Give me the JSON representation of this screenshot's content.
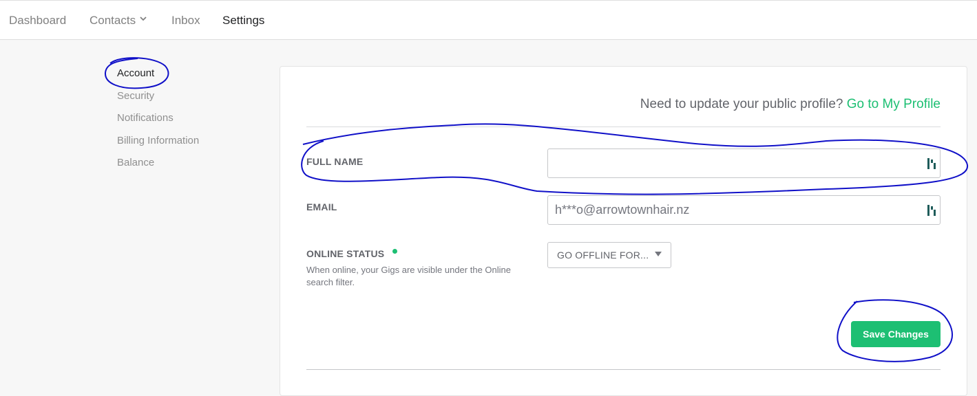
{
  "nav": {
    "items": [
      {
        "label": "Dashboard"
      },
      {
        "label": "Contacts"
      },
      {
        "label": "Inbox"
      },
      {
        "label": "Settings"
      }
    ]
  },
  "sidebar": {
    "items": [
      {
        "label": "Account"
      },
      {
        "label": "Security"
      },
      {
        "label": "Notifications"
      },
      {
        "label": "Billing Information"
      },
      {
        "label": "Balance"
      }
    ]
  },
  "profile_prompt": {
    "text": "Need to update your public profile?",
    "link": "Go to My Profile"
  },
  "form": {
    "full_name": {
      "label": "FULL NAME",
      "value": ""
    },
    "email": {
      "label": "EMAIL",
      "value": "h***o@arrowtownhair.nz"
    },
    "online_status": {
      "label": "ONLINE STATUS",
      "help": "When online, your Gigs are visible under the Online search filter.",
      "selected": "GO OFFLINE FOR..."
    }
  },
  "actions": {
    "save": "Save Changes"
  },
  "colors": {
    "accent": "#1dbf73",
    "annotation": "#1010c8"
  },
  "icons": {
    "contacts_dropdown": "chevron-down-icon",
    "password_manager": "password-manager-icon",
    "select_caret": "caret-down-icon",
    "status": "status-dot-icon"
  }
}
